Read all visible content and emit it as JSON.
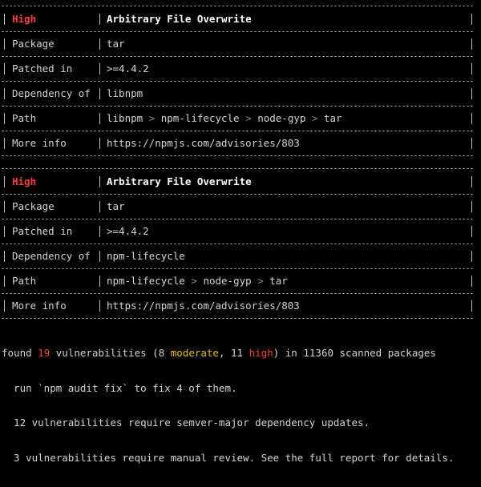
{
  "advisories": [
    {
      "severity": "High",
      "title": "Arbitrary File Overwrite",
      "rows": [
        {
          "key": "Package",
          "value": "tar"
        },
        {
          "key": "Patched in",
          "value": ">=4.4.2"
        },
        {
          "key": "Dependency of",
          "value": "libnpm"
        },
        {
          "key": "Path",
          "path": [
            "libnpm",
            "npm-lifecycle",
            "node-gyp",
            "tar"
          ]
        },
        {
          "key": "More info",
          "value": "https://npmjs.com/advisories/803"
        }
      ]
    },
    {
      "severity": "High",
      "title": "Arbitrary File Overwrite",
      "rows": [
        {
          "key": "Package",
          "value": "tar"
        },
        {
          "key": "Patched in",
          "value": ">=4.4.2"
        },
        {
          "key": "Dependency of",
          "value": "npm-lifecycle"
        },
        {
          "key": "Path",
          "path": [
            "npm-lifecycle",
            "node-gyp",
            "tar"
          ]
        },
        {
          "key": "More info",
          "value": "https://npmjs.com/advisories/803"
        }
      ]
    }
  ],
  "path_separator": ">",
  "summary": {
    "found_prefix": "found ",
    "total": "19",
    "mid1": " vulnerabilities (",
    "moderate_count": "8",
    "moderate_label": "moderate",
    "comma": ", ",
    "high_count": "11",
    "high_label": "high",
    "suffix": ") in 11360 scanned packages",
    "line2": "  run `npm audit fix` to fix 4 of them.",
    "line3": "  12 vulnerabilities require semver-major dependency updates.",
    "line4": "  3 vulnerabilities require manual review. See the full report for details."
  },
  "colors": {
    "background": "#000000",
    "severity_high": "#ff3b3b",
    "moderate": "#e5c100",
    "separator": "#8a8a8a"
  }
}
